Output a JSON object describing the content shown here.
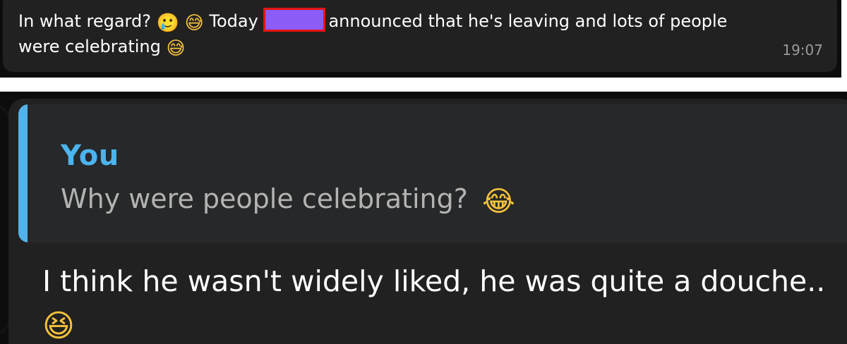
{
  "top_message": {
    "text_before": "In what regard?",
    "emoji_1": "🥲",
    "emoji_2": "😅",
    "text_after_emojis": "Today",
    "text_after_redaction": "announced that he's leaving and lots of people",
    "line_2": "were celebrating",
    "emoji_3": "😅",
    "time": "19:07"
  },
  "bottom_message": {
    "reply": {
      "author": "You",
      "text": "Why were people celebrating?",
      "emoji": "😂"
    },
    "text": "I think he wasn't widely liked, he was quite a douche..",
    "emoji": "😆"
  },
  "colors": {
    "background": "#0c0c0c",
    "bubble": "#212121",
    "reply_accent": "#51b3ea",
    "redaction_fill": "#8b5cf6",
    "redaction_border": "#e8120f"
  }
}
